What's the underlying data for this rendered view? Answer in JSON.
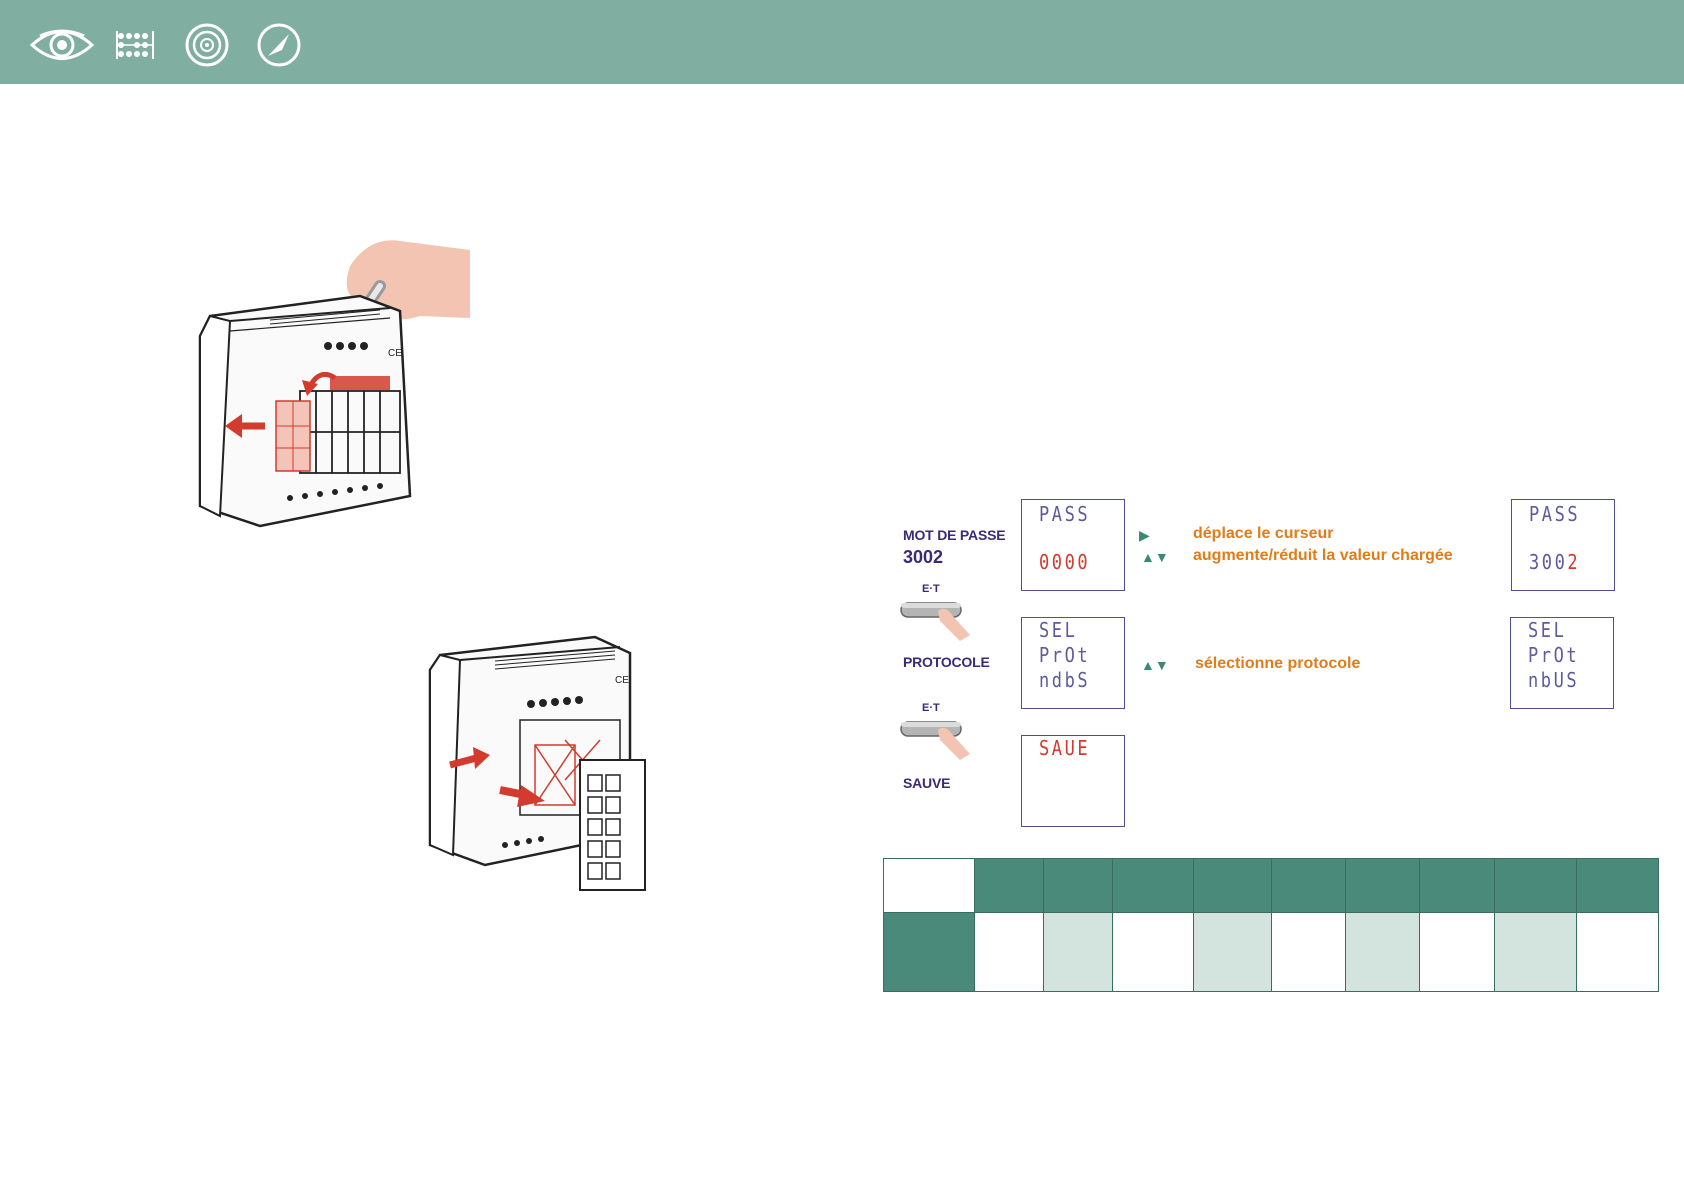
{
  "header": {
    "icons": [
      "eye-icon",
      "matrix-dots-icon",
      "target-icon",
      "compass-icon"
    ],
    "background": "#80afa2"
  },
  "steps": {
    "password": {
      "label": "MOT DE PASSE",
      "value": "3002",
      "display_before": {
        "line1": "PASS",
        "line2": "0000"
      },
      "display_after": {
        "line1": "PASS",
        "line2_prefix": "300",
        "line2_highlight": "2"
      },
      "hint_right_arrow": "déplace le curseur",
      "hint_updown_arrow": "augmente/réduit la valeur chargée"
    },
    "et_button_label": "E·T",
    "protocol": {
      "label": "PROTOCOLE",
      "display_before": {
        "line1": "SEL",
        "line2": "PrOt",
        "line3": "ndbS"
      },
      "display_after": {
        "line1": "SEL",
        "line2": "PrOt",
        "line3": "nbUS"
      },
      "hint": "sélectionne protocole"
    },
    "save": {
      "label": "SAUVE",
      "display": {
        "line1": "SAUE"
      }
    }
  },
  "colors": {
    "accent_teal": "#4a8a7a",
    "pale_teal": "#d3e4de",
    "label_purple": "#3b2a77",
    "hint_orange": "#e07d19",
    "lcd_red": "#d23b2e"
  }
}
